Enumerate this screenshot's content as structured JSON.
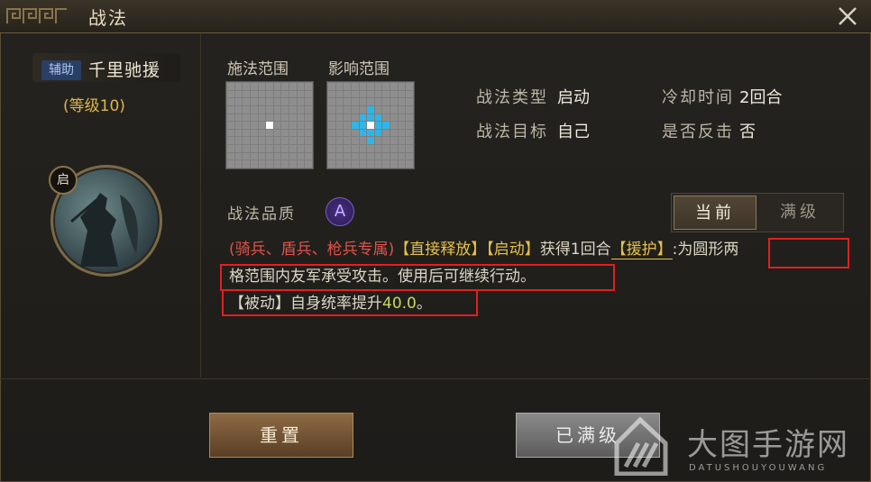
{
  "window": {
    "title": "战法"
  },
  "skill": {
    "type_badge": "辅助",
    "name": "千里驰援",
    "level": "(等级10)",
    "qi_badge": "启"
  },
  "grids": {
    "cast_label": "施法范围",
    "effect_label": "影响范围"
  },
  "info": {
    "type_key": "战法类型",
    "type_val": "启动",
    "cooldown_key": "冷却时间",
    "cooldown_val": "2回合",
    "target_key": "战法目标",
    "target_val": "自己",
    "counter_key": "是否反击",
    "counter_val": "否"
  },
  "quality": {
    "label": "战法品质",
    "grade": "A"
  },
  "tabs": {
    "current": "当前",
    "max": "满级"
  },
  "description": {
    "p1": "(骑兵、盾兵、枪兵专属)",
    "p2": "【直接释放】【启动】",
    "p3": "获得1回合",
    "p4": "【援护】",
    "p5": ":为圆形两",
    "p6": "格范围内友军承受攻击。使用后可继续行动。",
    "p7": "【被动】自身统率提升",
    "p8": "40.0",
    "p9": "。"
  },
  "buttons": {
    "reset": "重置",
    "maxed": "已满级"
  },
  "watermark": {
    "title": "大图手游网",
    "sub": "DATUSHOUYOUWANG"
  },
  "colors": {
    "accent_gold": "#e0b64a",
    "red_text": "#e0524a",
    "cyan_cell": "#2fb6e8"
  }
}
